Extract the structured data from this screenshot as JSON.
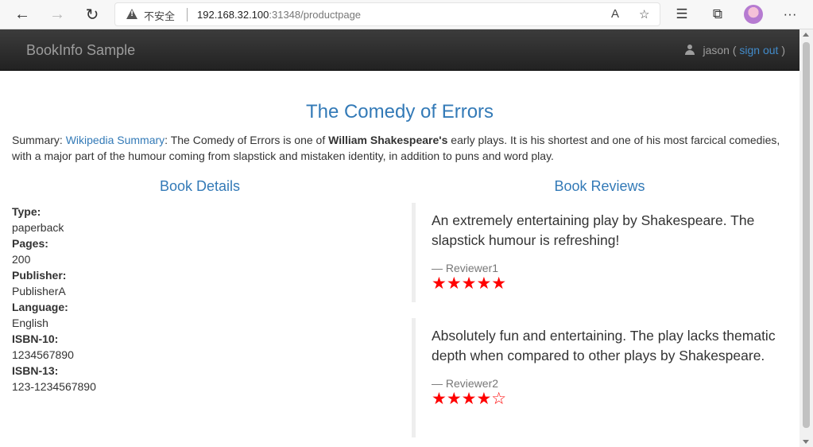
{
  "browser": {
    "back_icon": "←",
    "forward_icon": "→",
    "reload_icon": "↻",
    "insecure_label": "不安全",
    "url_host": "192.168.32.100",
    "url_rest": ":31348/productpage",
    "read_aloud_icon": "A",
    "favorite_icon": "☆",
    "favorites_icon": "☰",
    "collections_icon": "⧉",
    "more_icon": "···"
  },
  "navbar": {
    "brand": "BookInfo Sample",
    "user": "jason (",
    "sign_out": "sign out",
    "close_paren": ")"
  },
  "product": {
    "title": "The Comedy of Errors",
    "summary_label": "Summary: ",
    "summary_link": "Wikipedia Summary",
    "summary_text_1": ": The Comedy of Errors is one of ",
    "summary_bold": "William Shakespeare's",
    "summary_text_2": " early plays. It is his shortest and one of his most farcical comedies, with a major part of the humour coming from slapstick and mistaken identity, in addition to puns and word play."
  },
  "details": {
    "heading": "Book Details",
    "items": [
      {
        "label": "Type:",
        "value": "paperback"
      },
      {
        "label": "Pages:",
        "value": "200"
      },
      {
        "label": "Publisher:",
        "value": "PublisherA"
      },
      {
        "label": "Language:",
        "value": "English"
      },
      {
        "label": "ISBN-10:",
        "value": "1234567890"
      },
      {
        "label": "ISBN-13:",
        "value": "123-1234567890"
      }
    ]
  },
  "reviews": {
    "heading": "Book Reviews",
    "items": [
      {
        "text": "An extremely entertaining play by Shakespeare. The slapstick humour is refreshing!",
        "reviewer": "— Reviewer1",
        "stars": "★★★★★",
        "rating": 5
      },
      {
        "text": "Absolutely fun and entertaining. The play lacks thematic depth when compared to other plays by Shakespeare.",
        "reviewer": "— Reviewer2",
        "stars": "★★★★☆",
        "rating": 4
      }
    ],
    "star_color": "#ff0000"
  }
}
